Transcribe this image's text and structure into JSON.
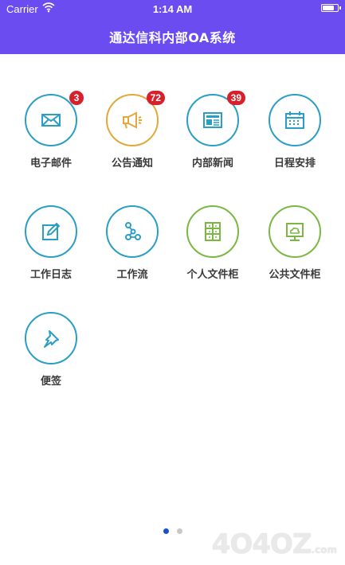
{
  "status_bar": {
    "carrier": "Carrier",
    "time": "1:14 AM",
    "battery_level": 0.85
  },
  "header": {
    "title": "通达信科内部OA系统"
  },
  "grid": [
    {
      "label": "电子邮件",
      "icon": "mail-icon",
      "color": "#2a9fc6",
      "badge": "3"
    },
    {
      "label": "公告通知",
      "icon": "megaphone-icon",
      "color": "#e2a83a",
      "badge": "72"
    },
    {
      "label": "内部新闻",
      "icon": "newspaper-icon",
      "color": "#2a9fc6",
      "badge": "39"
    },
    {
      "label": "日程安排",
      "icon": "calendar-icon",
      "color": "#2a9fc6",
      "badge": ""
    },
    {
      "label": "工作日志",
      "icon": "edit-icon",
      "color": "#2a9fc6",
      "badge": ""
    },
    {
      "label": "工作流",
      "icon": "workflow-icon",
      "color": "#2a9fc6",
      "badge": ""
    },
    {
      "label": "个人文件柜",
      "icon": "cabinet-icon",
      "color": "#7ab842",
      "badge": ""
    },
    {
      "label": "公共文件柜",
      "icon": "cloud-board-icon",
      "color": "#7ab842",
      "badge": ""
    },
    {
      "label": "便签",
      "icon": "pin-icon",
      "color": "#2a9fc6",
      "badge": ""
    }
  ],
  "pager": {
    "pages": 2,
    "current": 1
  },
  "watermark": {
    "text": "4O4OZ",
    "suffix": ".com"
  }
}
